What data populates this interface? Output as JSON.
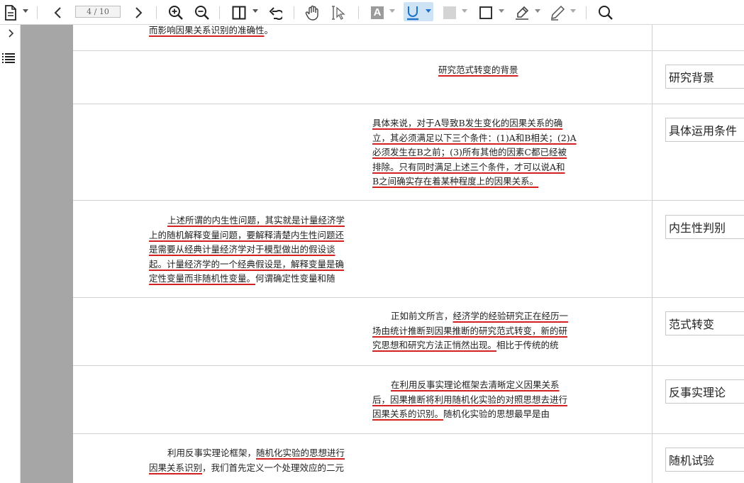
{
  "toolbar": {
    "page_indicator": "4 / 10",
    "icons": [
      "document-icon",
      "prev-page-icon",
      "next-page-icon",
      "zoom-in-icon",
      "zoom-out-icon",
      "panel-icon",
      "undo-icon",
      "hand-icon",
      "select-icon",
      "text-color-icon",
      "underline-icon",
      "fill-icon",
      "rectangle-icon",
      "highlighter-icon",
      "pen-icon",
      "search-icon"
    ],
    "text_color_glyph": "A",
    "underline_glyph": "U",
    "active_tool": "underline",
    "accent_color": "#1a73c8"
  },
  "sidebar": {
    "icons": [
      "expand-icon",
      "outline-list-icon"
    ]
  },
  "rows": [
    {
      "lines": [
        {
          "segments": [
            {
              "text": "而影响因果关系识别的准确性",
              "hl": true
            },
            {
              "text": "。",
              "hl": false
            }
          ]
        }
      ],
      "note": ""
    },
    {
      "lines": [
        {
          "segments": [
            {
              "text": "研究范式转变的背景",
              "hl": true
            }
          ]
        }
      ],
      "note": "研究背景"
    },
    {
      "lines": [
        {
          "segments": [
            {
              "text": "具体来说，对于A导致B发生变化的因果关系的确",
              "hl": true
            }
          ]
        },
        {
          "segments": [
            {
              "text": "立，其必须满足以下三个条件：(1)A和B相关；(2)A",
              "hl": true
            }
          ]
        },
        {
          "segments": [
            {
              "text": "必须发生在B之前；(3)所有其他的因素C都已经被",
              "hl": true
            }
          ]
        },
        {
          "segments": [
            {
              "text": "排除。只有同时满足上述三个条件，才可以说A和",
              "hl": true
            }
          ]
        },
        {
          "segments": [
            {
              "text": "B之间确实存在着某种程度上的因果关系。",
              "hl": true
            }
          ]
        }
      ],
      "note": "具体运用条件"
    },
    {
      "lines": [
        {
          "segments": [
            {
              "text": "上述所谓的内生性问题，其实就是计量经济学",
              "hl": true
            }
          ]
        },
        {
          "segments": [
            {
              "text": "上的随机解释变量问题，要解释清楚内生性问题还",
              "hl": true
            }
          ]
        },
        {
          "segments": [
            {
              "text": "是需要从经典计量经济学对于模型做出的假设谈",
              "hl": true
            }
          ]
        },
        {
          "segments": [
            {
              "text": "起。计量经济学的一个经典假设是，解释变量是确",
              "hl": true
            }
          ]
        },
        {
          "segments": [
            {
              "text": "定性变量而非随机性变量。",
              "hl": true
            },
            {
              "text": "何谓确定性变量和随",
              "hl": false
            }
          ]
        }
      ],
      "note": "内生性判别"
    },
    {
      "lines": [
        {
          "segments": [
            {
              "text": "正如前文所言，",
              "hl": false
            },
            {
              "text": "经济学的经验研究正在经历一",
              "hl": true
            }
          ]
        },
        {
          "segments": [
            {
              "text": "场由统计推断到因果推断的研究范式转变，新的研",
              "hl": true
            }
          ]
        },
        {
          "segments": [
            {
              "text": "究思想和研究方法正悄然出现。",
              "hl": true
            },
            {
              "text": "相比于传统的统",
              "hl": false
            }
          ]
        }
      ],
      "note": "范式转变"
    },
    {
      "lines": [
        {
          "segments": [
            {
              "text": "在利用反事实理论框架去清晰定义因果关系",
              "hl": true
            }
          ]
        },
        {
          "segments": [
            {
              "text": "后，因果推断将利用随机化实验的对照思想去进行",
              "hl": true
            }
          ]
        },
        {
          "segments": [
            {
              "text": "因果关系的识别。",
              "hl": true
            },
            {
              "text": "随机化实验的思想最早是由",
              "hl": false
            }
          ]
        }
      ],
      "note": "反事实理论"
    },
    {
      "lines": [
        {
          "segments": [
            {
              "text": "利用反事实理论框架，",
              "hl": false
            },
            {
              "text": "随机化实验的思想进行",
              "hl": true
            }
          ]
        },
        {
          "segments": [
            {
              "text": "因果关系识别",
              "hl": true
            },
            {
              "text": "，我们首先定义一个处理效应的二元",
              "hl": false
            }
          ]
        }
      ],
      "note": "随机试验"
    }
  ]
}
